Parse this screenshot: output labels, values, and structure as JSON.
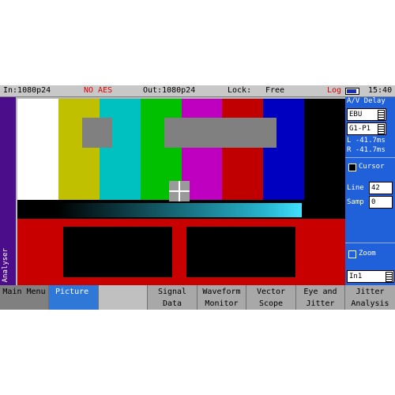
{
  "status": {
    "input": "In:1080p24",
    "aes": "NO AES",
    "output": "Out:1080p24",
    "lock_label": "Lock:",
    "lock_value": "Free",
    "log": "Log",
    "time": "15:40"
  },
  "left_tab": {
    "label": "Analyser"
  },
  "test_pattern": {
    "bar_colors": [
      "#ffffff",
      "#c0c000",
      "#00c0c0",
      "#00c000",
      "#c000c0",
      "#c00000",
      "#0000c0",
      "#000000"
    ]
  },
  "right_panel": {
    "av_delay_title": "A/V Delay",
    "standard": "EBU",
    "group": "G1-P1",
    "left_delay": "L -41.7ms",
    "right_delay": "R -41.7ms",
    "cursor_label": "Cursor",
    "line_label": "Line",
    "line_value": "42",
    "samp_label": "Samp",
    "samp_value": "0",
    "zoom_label": "Zoom",
    "zoom_value": "In1"
  },
  "menu": {
    "main_menu": "Main Menu",
    "picture": "Picture",
    "signal_1": "Signal",
    "signal_2": "Data",
    "waveform_1": "Waveform",
    "waveform_2": "Monitor",
    "vector_1": "Vector",
    "vector_2": "Scope",
    "eye_1": "Eye and",
    "eye_2": "Jitter",
    "jitter_1": "Jitter",
    "jitter_2": "Analysis"
  },
  "colors": {
    "accent": "#3078d8",
    "warning": "#e00000",
    "side_tab": "#4b0d8a"
  }
}
